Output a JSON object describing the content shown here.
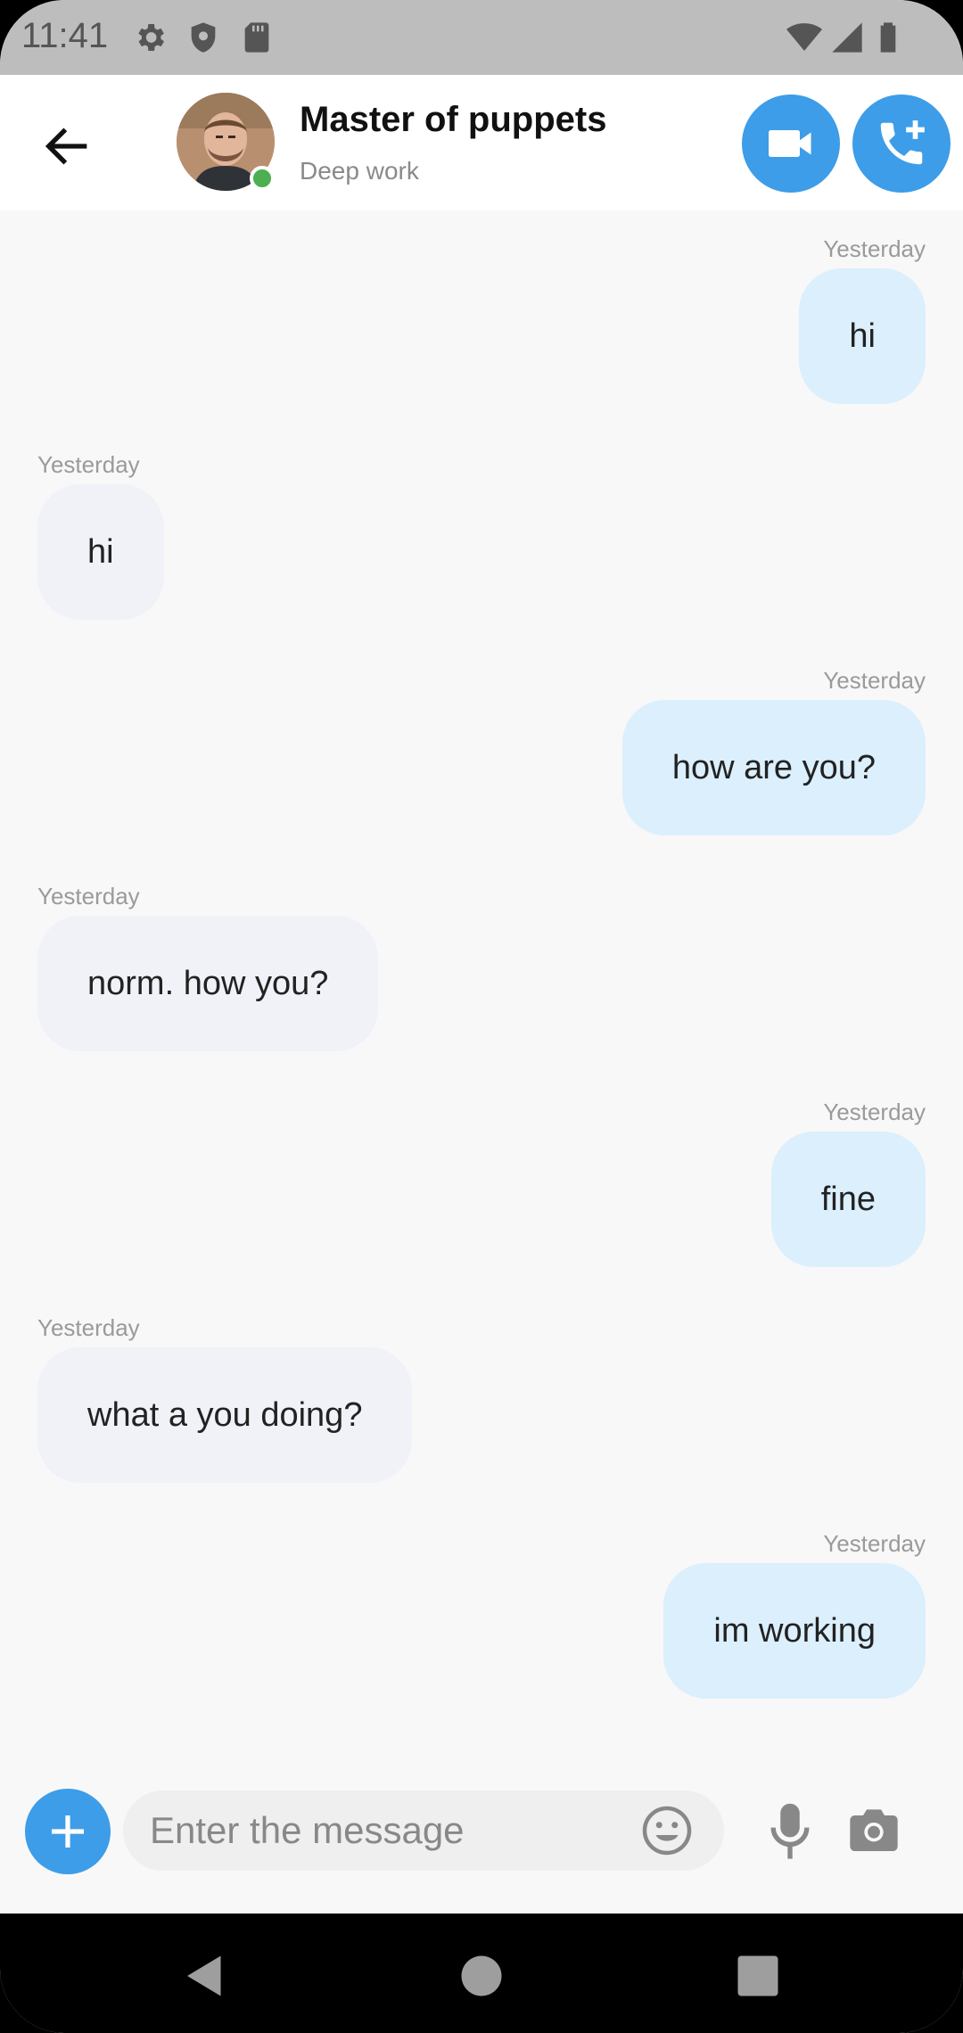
{
  "status_bar": {
    "time": "11:41",
    "icons_left": [
      "gear-icon",
      "shield-icon",
      "sd-card-icon"
    ],
    "icons_right": [
      "wifi-icon",
      "signal-icon",
      "battery-icon"
    ]
  },
  "header": {
    "contact_name": "Master of puppets",
    "contact_status": "Deep work",
    "online": true,
    "colors": {
      "accent": "#3d9de8",
      "online": "#4caf50"
    }
  },
  "messages": [
    {
      "direction": "out",
      "time": "Yesterday",
      "text": "hi"
    },
    {
      "direction": "in",
      "time": "Yesterday",
      "text": "hi"
    },
    {
      "direction": "out",
      "time": "Yesterday",
      "text": "how are you?"
    },
    {
      "direction": "in",
      "time": "Yesterday",
      "text": "norm. how you?"
    },
    {
      "direction": "out",
      "time": "Yesterday",
      "text": "fine"
    },
    {
      "direction": "in",
      "time": "Yesterday",
      "text": "what a you doing?"
    },
    {
      "direction": "out",
      "time": "Yesterday",
      "text": "im working"
    }
  ],
  "composer": {
    "placeholder": "Enter the message",
    "value": ""
  },
  "colors": {
    "outgoing_bubble": "#dbeffd",
    "incoming_bubble": "#f1f2f8",
    "background": "#f8f8f8"
  }
}
